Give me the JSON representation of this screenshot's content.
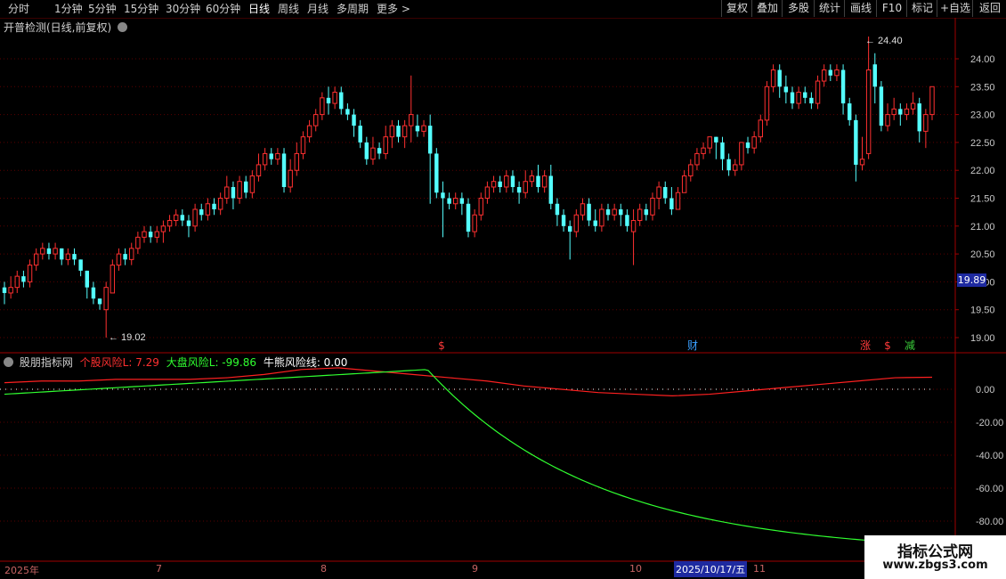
{
  "toolbar": {
    "periods": [
      "分时",
      "1分钟",
      "5分钟",
      "15分钟",
      "30分钟",
      "60分钟",
      "日线",
      "周线",
      "月线",
      "多周期",
      "更多 >"
    ],
    "active_period": "日线",
    "right_buttons": [
      "复权",
      "叠加",
      "多股",
      "统计",
      "画线",
      "F10",
      "标记",
      "+自选",
      "返回"
    ]
  },
  "main_chart": {
    "title": "开普检测(日线,前复权)",
    "price_ticks": [
      "24.00",
      "23.50",
      "23.00",
      "22.50",
      "22.00",
      "21.50",
      "21.00",
      "20.50",
      "20.00",
      "19.50",
      "19.00"
    ],
    "current_price": "19.89",
    "high_marker": "24.40",
    "low_marker": "19.02",
    "event_markers": [
      {
        "text": "$",
        "color": "#ff3a3a"
      },
      {
        "text": "财",
        "color": "#3aa0ff"
      },
      {
        "text": "涨",
        "color": "#ff3a3a"
      },
      {
        "text": "$",
        "color": "#ff3a3a"
      },
      {
        "text": "减",
        "color": "#3acc3a"
      }
    ]
  },
  "sub_chart": {
    "title": "股朋指标网",
    "legend": [
      {
        "label": "个股风险L: 7.29",
        "color": "#ff3030"
      },
      {
        "label": "大盘风险L: -99.86",
        "color": "#30ff30"
      },
      {
        "label": "牛熊风险线: 0.00",
        "color": "#ffffff"
      }
    ],
    "ticks": [
      "0.00",
      "-20.00",
      "-40.00",
      "-60.00",
      "-80.00"
    ]
  },
  "date_axis": {
    "labels": [
      "2025年",
      "7",
      "8",
      "9",
      "10",
      "11"
    ],
    "highlight": "2025/10/17/五"
  },
  "watermark": {
    "line1": "指标公式网",
    "line2": "www.zbgs3.com"
  },
  "chart_data": {
    "type": "candlestick",
    "price_range": [
      18.9,
      24.6
    ],
    "series": [
      {
        "name": "个股风险L",
        "values": [
          4,
          5,
          5,
          6,
          6,
          6,
          7,
          9,
          12,
          13,
          11,
          9,
          7,
          5,
          2,
          0,
          -2,
          -3,
          -4,
          -3,
          -1,
          1,
          3,
          5,
          7,
          7.29
        ]
      },
      {
        "name": "大盘风险L",
        "values": [
          -3,
          -1,
          0,
          1,
          2,
          3,
          5,
          7,
          9,
          11,
          12,
          -20,
          -60,
          -80,
          -88,
          -93,
          -96,
          -98,
          -99,
          -99.5,
          -99.7,
          -99.8,
          -99.86
        ]
      }
    ],
    "candles": [
      [
        19.9,
        19.8,
        20.0,
        19.6
      ],
      [
        19.8,
        19.9,
        20.1,
        19.7
      ],
      [
        19.9,
        20.1,
        20.2,
        19.8
      ],
      [
        20.1,
        20.0,
        20.2,
        19.9
      ],
      [
        20.0,
        20.3,
        20.4,
        19.9
      ],
      [
        20.3,
        20.5,
        20.6,
        20.2
      ],
      [
        20.5,
        20.6,
        20.7,
        20.4
      ],
      [
        20.6,
        20.5,
        20.7,
        20.4
      ],
      [
        20.5,
        20.6,
        20.7,
        20.4
      ],
      [
        20.6,
        20.4,
        20.6,
        20.3
      ],
      [
        20.4,
        20.5,
        20.6,
        20.3
      ],
      [
        20.5,
        20.4,
        20.6,
        20.3
      ],
      [
        20.4,
        20.2,
        20.4,
        20.1
      ],
      [
        20.2,
        19.9,
        20.2,
        19.7
      ],
      [
        19.9,
        19.7,
        20.0,
        19.6
      ],
      [
        19.7,
        19.6,
        19.7,
        19.5
      ],
      [
        19.5,
        19.9,
        20.0,
        19.0
      ],
      [
        19.8,
        20.3,
        20.4,
        19.8
      ],
      [
        20.3,
        20.5,
        20.6,
        20.2
      ],
      [
        20.5,
        20.4,
        20.6,
        20.3
      ],
      [
        20.4,
        20.6,
        20.7,
        20.3
      ],
      [
        20.6,
        20.8,
        20.9,
        20.5
      ],
      [
        20.8,
        20.9,
        21.0,
        20.7
      ],
      [
        20.9,
        20.8,
        21.0,
        20.7
      ],
      [
        20.8,
        20.9,
        21.0,
        20.7
      ],
      [
        20.9,
        21.0,
        21.1,
        20.7
      ],
      [
        21.0,
        21.1,
        21.2,
        20.9
      ],
      [
        21.1,
        21.2,
        21.3,
        21.0
      ],
      [
        21.2,
        21.1,
        21.3,
        21.0
      ],
      [
        21.1,
        21.0,
        21.2,
        20.8
      ],
      [
        21.0,
        21.3,
        21.4,
        20.9
      ],
      [
        21.3,
        21.2,
        21.4,
        21.1
      ],
      [
        21.2,
        21.4,
        21.5,
        21.1
      ],
      [
        21.4,
        21.3,
        21.5,
        21.2
      ],
      [
        21.3,
        21.5,
        21.6,
        21.2
      ],
      [
        21.5,
        21.7,
        21.9,
        21.4
      ],
      [
        21.7,
        21.5,
        21.8,
        21.3
      ],
      [
        21.5,
        21.8,
        21.9,
        21.4
      ],
      [
        21.8,
        21.6,
        21.9,
        21.5
      ],
      [
        21.6,
        21.9,
        22.0,
        21.5
      ],
      [
        21.9,
        22.1,
        22.3,
        21.8
      ],
      [
        22.1,
        22.3,
        22.4,
        22.0
      ],
      [
        22.3,
        22.2,
        22.4,
        22.1
      ],
      [
        22.2,
        22.3,
        22.4,
        22.1
      ],
      [
        22.3,
        21.7,
        22.4,
        21.6
      ],
      [
        21.7,
        22.0,
        22.2,
        21.6
      ],
      [
        22.0,
        22.3,
        22.5,
        21.9
      ],
      [
        22.3,
        22.6,
        22.7,
        22.2
      ],
      [
        22.6,
        22.8,
        22.9,
        22.5
      ],
      [
        22.8,
        23.0,
        23.1,
        22.7
      ],
      [
        23.0,
        23.3,
        23.4,
        22.9
      ],
      [
        23.3,
        23.2,
        23.5,
        23.0
      ],
      [
        23.2,
        23.4,
        23.5,
        23.1
      ],
      [
        23.4,
        23.1,
        23.5,
        23.0
      ],
      [
        23.1,
        23.0,
        23.2,
        22.9
      ],
      [
        23.0,
        22.8,
        23.1,
        22.6
      ],
      [
        22.8,
        22.5,
        22.9,
        22.4
      ],
      [
        22.5,
        22.2,
        22.6,
        22.1
      ],
      [
        22.2,
        22.4,
        22.6,
        22.1
      ],
      [
        22.4,
        22.3,
        22.5,
        22.2
      ],
      [
        22.3,
        22.6,
        22.8,
        22.2
      ],
      [
        22.6,
        22.8,
        22.9,
        22.4
      ],
      [
        22.8,
        22.6,
        22.9,
        22.5
      ],
      [
        22.6,
        22.8,
        22.9,
        22.4
      ],
      [
        22.8,
        23.0,
        23.7,
        22.5
      ],
      [
        22.8,
        22.7,
        23.0,
        22.6
      ],
      [
        22.7,
        22.8,
        22.9,
        22.6
      ],
      [
        22.8,
        22.3,
        23.0,
        21.4
      ],
      [
        22.3,
        21.6,
        22.4,
        21.5
      ],
      [
        21.6,
        21.5,
        21.8,
        20.8
      ],
      [
        21.5,
        21.4,
        21.6,
        21.3
      ],
      [
        21.4,
        21.5,
        21.6,
        21.3
      ],
      [
        21.5,
        21.4,
        21.6,
        21.2
      ],
      [
        21.4,
        20.9,
        21.5,
        20.8
      ],
      [
        20.9,
        21.2,
        21.3,
        20.8
      ],
      [
        21.2,
        21.5,
        21.6,
        21.1
      ],
      [
        21.5,
        21.7,
        21.8,
        21.4
      ],
      [
        21.7,
        21.8,
        21.9,
        21.6
      ],
      [
        21.8,
        21.7,
        21.9,
        21.6
      ],
      [
        21.7,
        21.9,
        22.0,
        21.6
      ],
      [
        21.9,
        21.7,
        22.0,
        21.6
      ],
      [
        21.7,
        21.6,
        21.8,
        21.4
      ],
      [
        21.6,
        21.8,
        22.0,
        21.5
      ],
      [
        21.8,
        21.9,
        22.0,
        21.7
      ],
      [
        21.9,
        21.7,
        22.1,
        21.6
      ],
      [
        21.7,
        21.9,
        22.0,
        21.6
      ],
      [
        21.9,
        21.4,
        22.1,
        21.3
      ],
      [
        21.4,
        21.2,
        21.5,
        21.0
      ],
      [
        21.2,
        21.0,
        21.3,
        20.9
      ],
      [
        21.0,
        20.9,
        21.1,
        20.4
      ],
      [
        20.9,
        21.2,
        21.3,
        20.8
      ],
      [
        21.2,
        21.4,
        21.5,
        21.1
      ],
      [
        21.4,
        21.1,
        21.5,
        21.0
      ],
      [
        21.1,
        21.0,
        21.3,
        20.9
      ],
      [
        21.0,
        21.3,
        21.4,
        20.9
      ],
      [
        21.3,
        21.2,
        21.4,
        21.1
      ],
      [
        21.2,
        21.3,
        21.4,
        21.1
      ],
      [
        21.3,
        21.2,
        21.4,
        21.0
      ],
      [
        21.2,
        21.0,
        21.3,
        20.9
      ],
      [
        20.9,
        21.1,
        21.3,
        20.3
      ],
      [
        21.1,
        21.3,
        21.4,
        21.0
      ],
      [
        21.3,
        21.2,
        21.4,
        21.1
      ],
      [
        21.2,
        21.5,
        21.6,
        21.1
      ],
      [
        21.5,
        21.7,
        21.8,
        21.3
      ],
      [
        21.7,
        21.5,
        21.8,
        21.4
      ],
      [
        21.5,
        21.3,
        21.7,
        21.2
      ],
      [
        21.3,
        21.6,
        21.7,
        21.3
      ],
      [
        21.6,
        21.9,
        22.0,
        21.6
      ],
      [
        21.9,
        22.1,
        22.2,
        21.8
      ],
      [
        22.1,
        22.3,
        22.4,
        22.0
      ],
      [
        22.3,
        22.4,
        22.5,
        22.2
      ],
      [
        22.4,
        22.6,
        22.6,
        22.3
      ],
      [
        22.6,
        22.5,
        22.6,
        22.2
      ],
      [
        22.5,
        22.2,
        22.6,
        22.0
      ],
      [
        22.2,
        22.0,
        22.3,
        21.9
      ],
      [
        22.0,
        22.1,
        22.2,
        21.9
      ],
      [
        22.1,
        22.5,
        22.5,
        22.0
      ],
      [
        22.5,
        22.4,
        22.6,
        22.3
      ],
      [
        22.4,
        22.6,
        22.7,
        22.3
      ],
      [
        22.6,
        22.9,
        23.0,
        22.5
      ],
      [
        22.9,
        23.5,
        23.6,
        22.8
      ],
      [
        23.5,
        23.8,
        23.9,
        23.4
      ],
      [
        23.8,
        23.5,
        23.9,
        23.3
      ],
      [
        23.5,
        23.4,
        23.7,
        23.2
      ],
      [
        23.4,
        23.2,
        23.5,
        23.1
      ],
      [
        23.2,
        23.4,
        23.5,
        23.1
      ],
      [
        23.4,
        23.3,
        23.5,
        23.2
      ],
      [
        23.3,
        23.2,
        23.4,
        23.1
      ],
      [
        23.2,
        23.6,
        23.7,
        23.1
      ],
      [
        23.6,
        23.8,
        23.9,
        23.5
      ],
      [
        23.8,
        23.7,
        23.9,
        23.6
      ],
      [
        23.7,
        23.8,
        23.9,
        23.6
      ],
      [
        23.8,
        23.2,
        23.9,
        23.0
      ],
      [
        23.2,
        22.9,
        23.3,
        22.8
      ],
      [
        22.9,
        22.1,
        23.0,
        21.8
      ],
      [
        22.1,
        22.2,
        22.6,
        22.0
      ],
      [
        22.3,
        23.8,
        24.4,
        22.2
      ],
      [
        23.9,
        23.5,
        24.1,
        23.2
      ],
      [
        23.5,
        22.8,
        23.6,
        22.7
      ],
      [
        22.8,
        23.0,
        23.2,
        22.7
      ],
      [
        23.0,
        23.1,
        23.3,
        22.9
      ],
      [
        23.1,
        23.0,
        23.2,
        22.8
      ],
      [
        23.0,
        23.1,
        23.2,
        22.9
      ],
      [
        23.1,
        23.2,
        23.4,
        23.0
      ],
      [
        23.2,
        22.7,
        23.3,
        22.5
      ],
      [
        22.7,
        23.0,
        23.1,
        22.4
      ],
      [
        23.0,
        23.5,
        23.5,
        22.9
      ]
    ]
  }
}
